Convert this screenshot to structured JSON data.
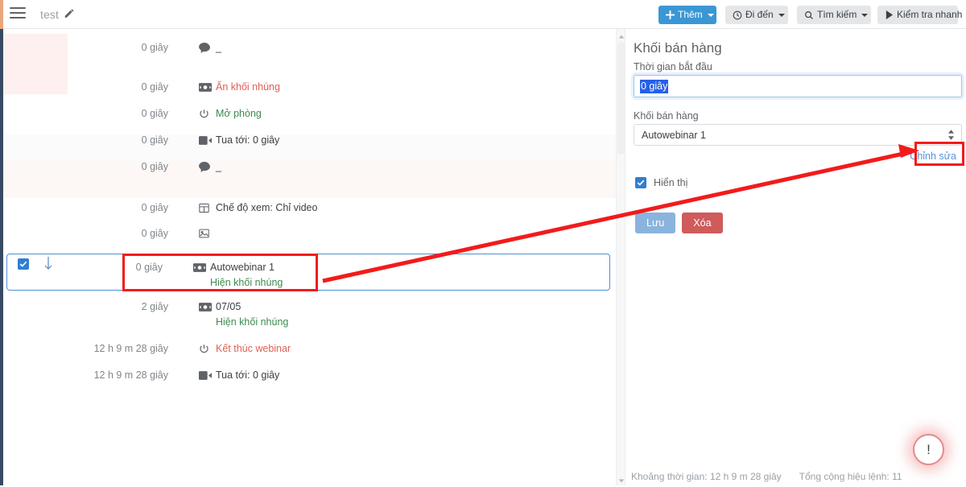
{
  "topbar": {
    "menu_icon": "hamburger-icon",
    "doc_title": "test",
    "edit_icon": "pencil-icon",
    "buttons": [
      {
        "id": "them",
        "label": "Thêm",
        "icon": "plus-icon",
        "caret": true,
        "style": "primary"
      },
      {
        "id": "dien",
        "label": "Đi đến",
        "icon": "clock-icon",
        "caret": true,
        "style": "default"
      },
      {
        "id": "timkiem",
        "label": "Tìm kiếm",
        "icon": "search-icon",
        "caret": true,
        "style": "default"
      },
      {
        "id": "kiemtra",
        "label": "Kiểm tra nhanh",
        "icon": "play-icon",
        "caret": false,
        "style": "default"
      }
    ]
  },
  "timeline": {
    "rows": [
      {
        "time": "0 giây",
        "icon": "comment-icon",
        "label": "_",
        "label_color": "default",
        "sub": ""
      },
      {
        "time": "0 giây",
        "icon": "banner-icon",
        "label": "Ẩn khối nhúng",
        "label_color": "red",
        "sub": ""
      },
      {
        "time": "0 giây",
        "icon": "power-icon",
        "label": "Mở phòng",
        "label_color": "green",
        "sub": ""
      },
      {
        "time": "0 giây",
        "icon": "video-icon",
        "label": "Tua tới: 0 giây",
        "label_color": "default",
        "sub": ""
      },
      {
        "time": "0 giây",
        "icon": "comment-icon",
        "label": "_",
        "label_color": "default",
        "sub": ""
      },
      {
        "time": "0 giây",
        "icon": "layout-icon",
        "label": "Chế độ xem: Chỉ video",
        "label_color": "default",
        "sub": ""
      },
      {
        "time": "0 giây",
        "icon": "image-icon",
        "label": "",
        "label_color": "default",
        "sub": ""
      }
    ],
    "selected_row": {
      "time": "0 giây",
      "icon": "banner-icon",
      "label": "Autowebinar 1",
      "sub": "Hiện khối nhúng",
      "checkbox_checked": true,
      "move_icon": "arrow-down-icon"
    },
    "rows_after": [
      {
        "time": "2 giây",
        "icon": "banner-icon",
        "label": "07/05",
        "label_color": "default",
        "sub": "Hiện khối nhúng"
      },
      {
        "time": "12 h 9 m 28 giây",
        "icon": "power-icon",
        "label": "Kết thúc webinar",
        "label_color": "red",
        "sub": ""
      },
      {
        "time": "12 h 9 m 28 giây",
        "icon": "video-icon",
        "label": "Tua tới: 0 giây",
        "label_color": "default",
        "sub": ""
      }
    ]
  },
  "panel": {
    "title": "Khối bán hàng",
    "start_time_label": "Thời gian bắt đầu",
    "start_time_value": "0 giây",
    "block_label": "Khối bán hàng",
    "block_value": "Autowebinar 1",
    "edit_link": "Chỉnh sửa",
    "show_checkbox_label": "Hiển thị",
    "show_checkbox_checked": true,
    "save_label": "Lưu",
    "delete_label": "Xóa"
  },
  "statusbar": {
    "duration": "Khoảng thời gian: 12 h 9 m 28 giây",
    "total_commands": "Tổng cộng hiệu lệnh: 11"
  },
  "alert": {
    "glyph": "!"
  },
  "colors": {
    "accent_blue": "#3a97d4",
    "selection_blue": "#2660e8",
    "danger_red": "#cf5b5b",
    "annotation_red": "#f21b1b",
    "green": "#3e8a4f",
    "rail_navy": "#384a63"
  }
}
